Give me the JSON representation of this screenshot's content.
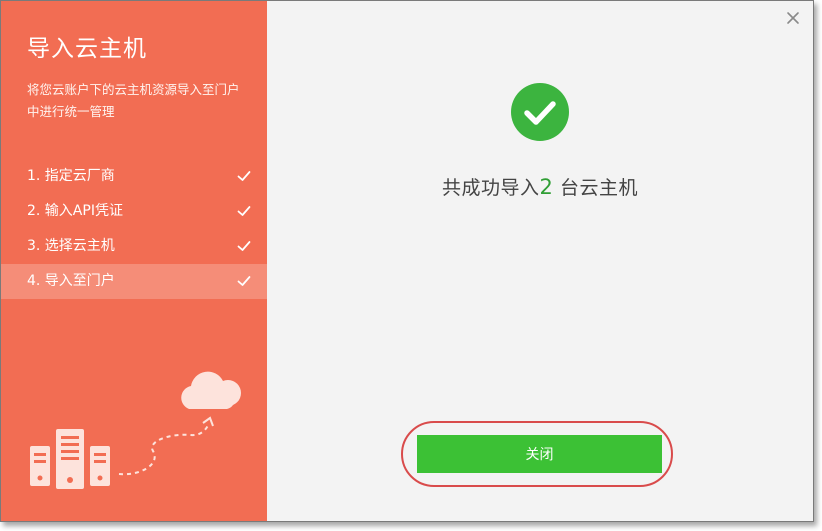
{
  "sidebar": {
    "title": "导入云主机",
    "description": "将您云账户下的云主机资源导入至门户中进行统一管理",
    "steps": [
      {
        "label": "1. 指定云厂商",
        "done": true
      },
      {
        "label": "2. 输入API凭证",
        "done": true
      },
      {
        "label": "3. 选择云主机",
        "done": true
      },
      {
        "label": "4. 导入至门户",
        "done": true,
        "active": true
      }
    ],
    "illustration_icons": [
      "cloud-icon",
      "server-icon",
      "arrow-icon"
    ]
  },
  "result": {
    "prefix": "共成功导入",
    "count": "2",
    "suffix": " 台云主机",
    "icon": "success-check-icon"
  },
  "buttons": {
    "close_label": "关闭",
    "close_icon": "close-x-icon"
  },
  "colors": {
    "sidebar_bg": "#f26d53",
    "success_green": "#3cb43f",
    "button_green": "#3cc135",
    "highlight_ring": "#d94b4b",
    "main_bg": "#f3f3f3"
  }
}
